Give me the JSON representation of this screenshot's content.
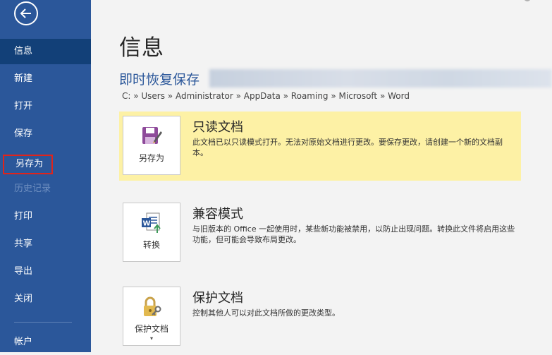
{
  "sidebar": {
    "items": [
      {
        "label": "信息"
      },
      {
        "label": "新建"
      },
      {
        "label": "打开"
      },
      {
        "label": "保存"
      },
      {
        "label": "另存为"
      },
      {
        "label": "历史记录"
      },
      {
        "label": "打印"
      },
      {
        "label": "共享"
      },
      {
        "label": "导出"
      },
      {
        "label": "关闭"
      },
      {
        "label": "帐户"
      }
    ]
  },
  "main": {
    "title": "信息",
    "recover_title": "即时恢复保存",
    "path": "C: » Users » Administrator » AppData » Roaming » Microsoft » Word",
    "cards": [
      {
        "tile_label": "另存为",
        "heading": "只读文档",
        "description": "此文档已以只读模式打开。无法对原始文档进行更改。要保存更改，请创建一个新的文档副本。"
      },
      {
        "tile_label": "转换",
        "heading": "兼容模式",
        "description": "与旧版本的 Office 一起使用时，某些新功能被禁用，以防止出现问题。转换此文件将启用这些功能，但可能会导致布局更改。"
      },
      {
        "tile_label": "保护文档",
        "tile_caret": "▾",
        "heading": "保护文档",
        "description": "控制其他人可以对此文档所做的更改类型。"
      }
    ]
  },
  "colors": {
    "sidebar_bg": "#2b579a",
    "sidebar_active": "#124078",
    "readonly_card_bg": "#fdf1a5",
    "highlight_border": "#e0241b"
  }
}
